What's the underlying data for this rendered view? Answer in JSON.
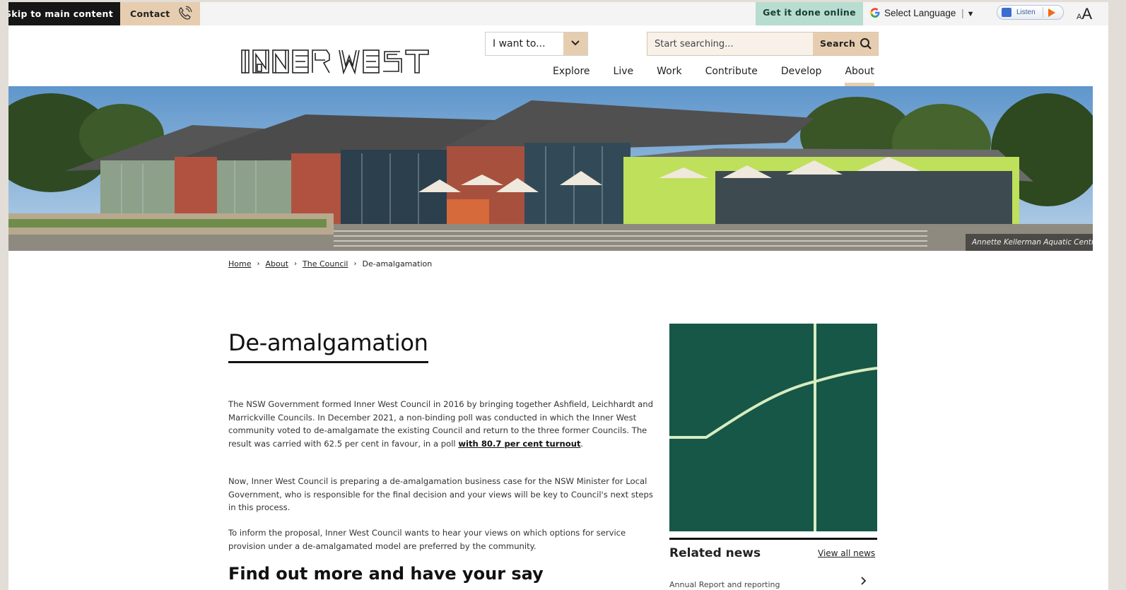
{
  "utility_bar": {
    "skip_label": "Skip to main content",
    "contact_label": "Contact",
    "get_it_done_label": "Get it done online",
    "language_label": "Select Language",
    "language_arrow": "▼",
    "listen_label": "Listen",
    "text_size_small": "A",
    "text_size_large": "A",
    "colors": {
      "contact_bg": "#e7cdb0",
      "get_it_done_bg": "#b6ddd0",
      "skip_bg": "#161616"
    }
  },
  "header": {
    "logo_text": "INNER WEST",
    "i_want_label": "I want to...",
    "search_placeholder": "Start searching...",
    "search_button": "Search",
    "nav": [
      {
        "label": "Explore"
      },
      {
        "label": "Live"
      },
      {
        "label": "Work"
      },
      {
        "label": "Contribute"
      },
      {
        "label": "Develop"
      },
      {
        "label": "About",
        "active": true
      }
    ]
  },
  "hero": {
    "caption": "Annette Kellerman Aquatic Centre"
  },
  "breadcrumb": [
    {
      "label": "Home",
      "link": true
    },
    {
      "label": "About",
      "link": true
    },
    {
      "label": "The Council",
      "link": true
    },
    {
      "label": "De-amalgamation",
      "link": false
    }
  ],
  "breadcrumb_separator": "›",
  "main": {
    "title": "De-amalgamation",
    "p1_text": "The NSW Government formed Inner West Council in 2016 by bringing together Ashfield, Leichhardt and Marrickville Councils. In December 2021, a non-binding poll was conducted in which the Inner West community voted to de-amalgamate the existing Council and return to the three former Councils. The result was carried with 62.5 per cent in favour, in a poll ",
    "p1_link": "with 80.7 per cent turnout",
    "p1_end": ".",
    "p2_text": "Now, Inner West Council is preparing a de-amalgamation business case for the NSW Minister for Local Government, who is responsible for the final decision and your views will be key to Council's next steps in this process.",
    "p3_text": "To inform the proposal, Inner West Council wants to hear your views on which options for service provision under a de-amalgamated model are preferred by the community.",
    "subheading": "Find out more and have your say"
  },
  "sidebar": {
    "tile_color": "#165747",
    "tile_line_color": "#d7ecc1",
    "related_title": "Related news",
    "view_all": "View all news",
    "news_item": "Annual Report and reporting"
  }
}
